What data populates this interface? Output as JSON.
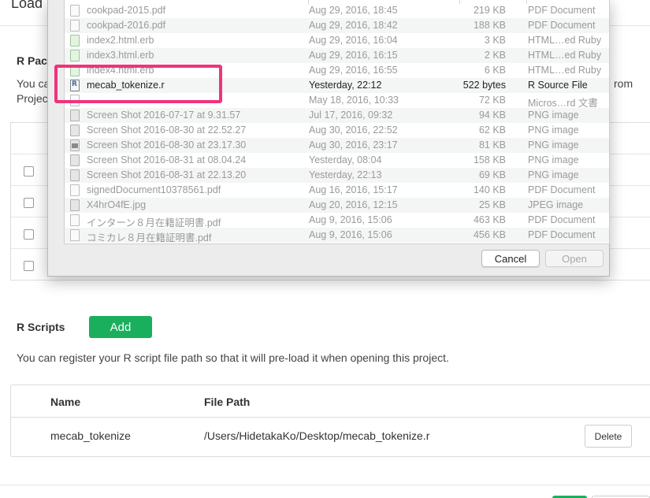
{
  "page": {
    "title": "Load",
    "packages_label": "R Pac",
    "packages_desc_left": "You ca",
    "packages_desc_left2": "Projec",
    "packages_desc_right": "rom"
  },
  "scripts": {
    "label": "R Scripts",
    "add_label": "Add",
    "description": "You can register your R script file path so that it will pre-load it when opening this project.",
    "table_headers": {
      "name": "Name",
      "path": "File Path"
    },
    "rows": [
      {
        "name": "mecab_tokenize",
        "path": "/Users/HidetakaKo/Desktop/mecab_tokenize.r",
        "delete_label": "Delete"
      }
    ]
  },
  "dialog": {
    "files": [
      {
        "name": "cookpad-2015.pdf",
        "date": "Aug 29, 2016, 18:45",
        "size": "219 KB",
        "kind": "PDF Document",
        "icon": "pdf-file-icon"
      },
      {
        "name": "cookpad-2016.pdf",
        "date": "Aug 29, 2016, 18:42",
        "size": "188 KB",
        "kind": "PDF Document",
        "icon": "pdf-file-icon"
      },
      {
        "name": "index2.html.erb",
        "date": "Aug 29, 2016, 16:04",
        "size": "3 KB",
        "kind": "HTML…ed Ruby",
        "icon": "erb-file-icon"
      },
      {
        "name": "index3.html.erb",
        "date": "Aug 29, 2016, 16:15",
        "size": "2 KB",
        "kind": "HTML…ed Ruby",
        "icon": "erb-file-icon"
      },
      {
        "name": "index4.html.erb",
        "date": "Aug 29, 2016, 16:55",
        "size": "6 KB",
        "kind": "HTML…ed Ruby",
        "icon": "erb-file-icon"
      },
      {
        "name": "mecab_tokenize.r",
        "date": "Yesterday, 22:12",
        "size": "522 bytes",
        "kind": "R Source File",
        "icon": "r-source-file-icon",
        "enabled": true
      },
      {
        "name": "",
        "date": "May 18, 2016, 10:33",
        "size": "72 KB",
        "kind": "Micros…rd 文書",
        "icon": "word-file-icon"
      },
      {
        "name": "Screen Shot 2016-07-17 at 9.31.57",
        "date": "Jul 17, 2016, 09:32",
        "size": "94 KB",
        "kind": "PNG image",
        "icon": "image-file-icon"
      },
      {
        "name": "Screen Shot 2016-08-30 at 22.52.27",
        "date": "Aug 30, 2016, 22:52",
        "size": "62 KB",
        "kind": "PNG image",
        "icon": "image-file-icon"
      },
      {
        "name": "Screen Shot 2016-08-30 at 23.17.30",
        "date": "Aug 30, 2016, 23:17",
        "size": "81 KB",
        "kind": "PNG image",
        "icon": "image-file-icon"
      },
      {
        "name": "Screen Shot 2016-08-31 at 08.04.24",
        "date": "Yesterday, 08:04",
        "size": "158 KB",
        "kind": "PNG image",
        "icon": "image-file-icon"
      },
      {
        "name": "Screen Shot 2016-08-31 at 22.13.20",
        "date": "Yesterday, 22:13",
        "size": "69 KB",
        "kind": "PNG image",
        "icon": "image-file-icon"
      },
      {
        "name": "signedDocument10378561.pdf",
        "date": "Aug 16, 2016, 15:17",
        "size": "140 KB",
        "kind": "PDF Document",
        "icon": "pdf-file-icon"
      },
      {
        "name": "X4hrO4fE.jpg",
        "date": "Aug 20, 2016, 12:15",
        "size": "25 KB",
        "kind": "JPEG image",
        "icon": "image-file-icon"
      },
      {
        "name": "インターン８月在籍証明書.pdf",
        "date": "Aug 9, 2016, 15:06",
        "size": "463 KB",
        "kind": "PDF Document",
        "icon": "pdf-file-icon"
      },
      {
        "name": "コミカレ８月在籍証明書.pdf",
        "date": "Aug 9, 2016, 15:06",
        "size": "456 KB",
        "kind": "PDF Document",
        "icon": "pdf-file-icon"
      }
    ],
    "cancel_label": "Cancel",
    "open_label": "Open"
  },
  "colors": {
    "add_button": "#1aaf5d",
    "highlight": "#f0337d"
  }
}
